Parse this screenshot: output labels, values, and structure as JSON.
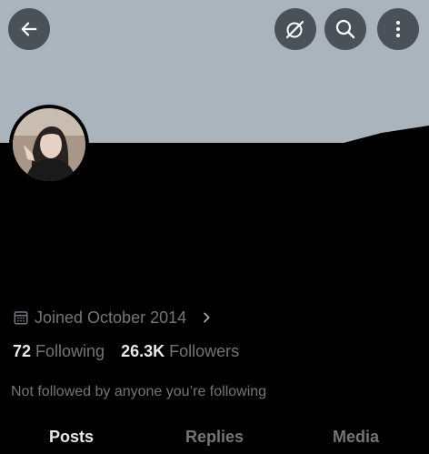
{
  "header": {
    "back_icon": "arrow-left-icon",
    "translate_icon": "grok-icon",
    "search_icon": "search-icon",
    "more_icon": "more-vertical-icon",
    "banner_color": "#aab4bd"
  },
  "profile": {
    "joined_text": "Joined October 2014",
    "following_count": "72",
    "following_label": "Following",
    "followers_count": "26.3K",
    "followers_label": "Followers",
    "not_followed_text": "Not followed by anyone you’re following"
  },
  "tabs": [
    {
      "label": "Posts",
      "active": true
    },
    {
      "label": "Replies",
      "active": false
    },
    {
      "label": "Media",
      "active": false
    }
  ]
}
